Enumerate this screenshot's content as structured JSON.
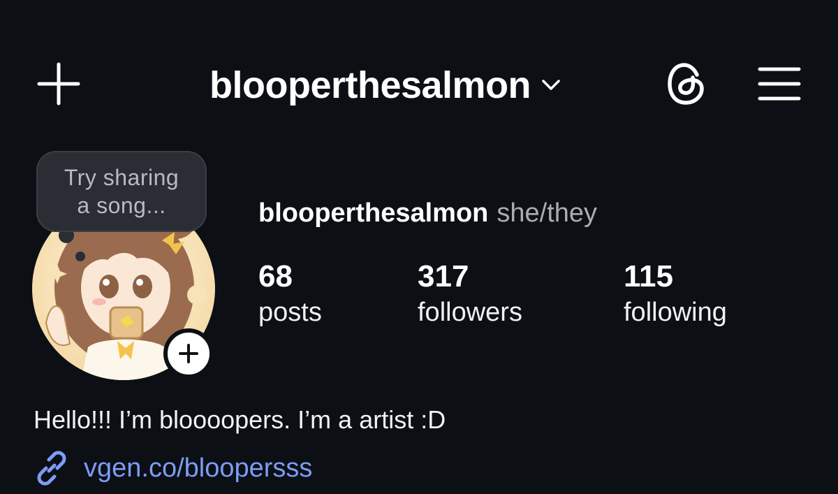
{
  "topbar": {
    "username": "blooperthesalmon",
    "add_icon": "plus-icon",
    "dropdown_icon": "chevron-down-icon",
    "threads_icon": "threads-icon",
    "menu_icon": "hamburger-menu-icon"
  },
  "note": {
    "line1": "Try sharing",
    "line2": "a song..."
  },
  "profile": {
    "username": "blooperthesalmon",
    "pronouns": "she/they",
    "avatar_icon": "avatar",
    "add_story_icon": "plus-icon"
  },
  "stats": [
    {
      "value": "68",
      "label": "posts"
    },
    {
      "value": "317",
      "label": "followers"
    },
    {
      "value": "115",
      "label": "following"
    }
  ],
  "bio": {
    "text": "Hello!!! I’m bloooopers. I’m a artist :D",
    "link": "vgen.co/bloopersss",
    "link_icon": "link-icon"
  },
  "colors": {
    "background": "#0c0f14",
    "text": "#ffffff",
    "secondary_text": "#a8acb3",
    "link": "#7d9cf5",
    "bubble": "#2a2d33"
  }
}
